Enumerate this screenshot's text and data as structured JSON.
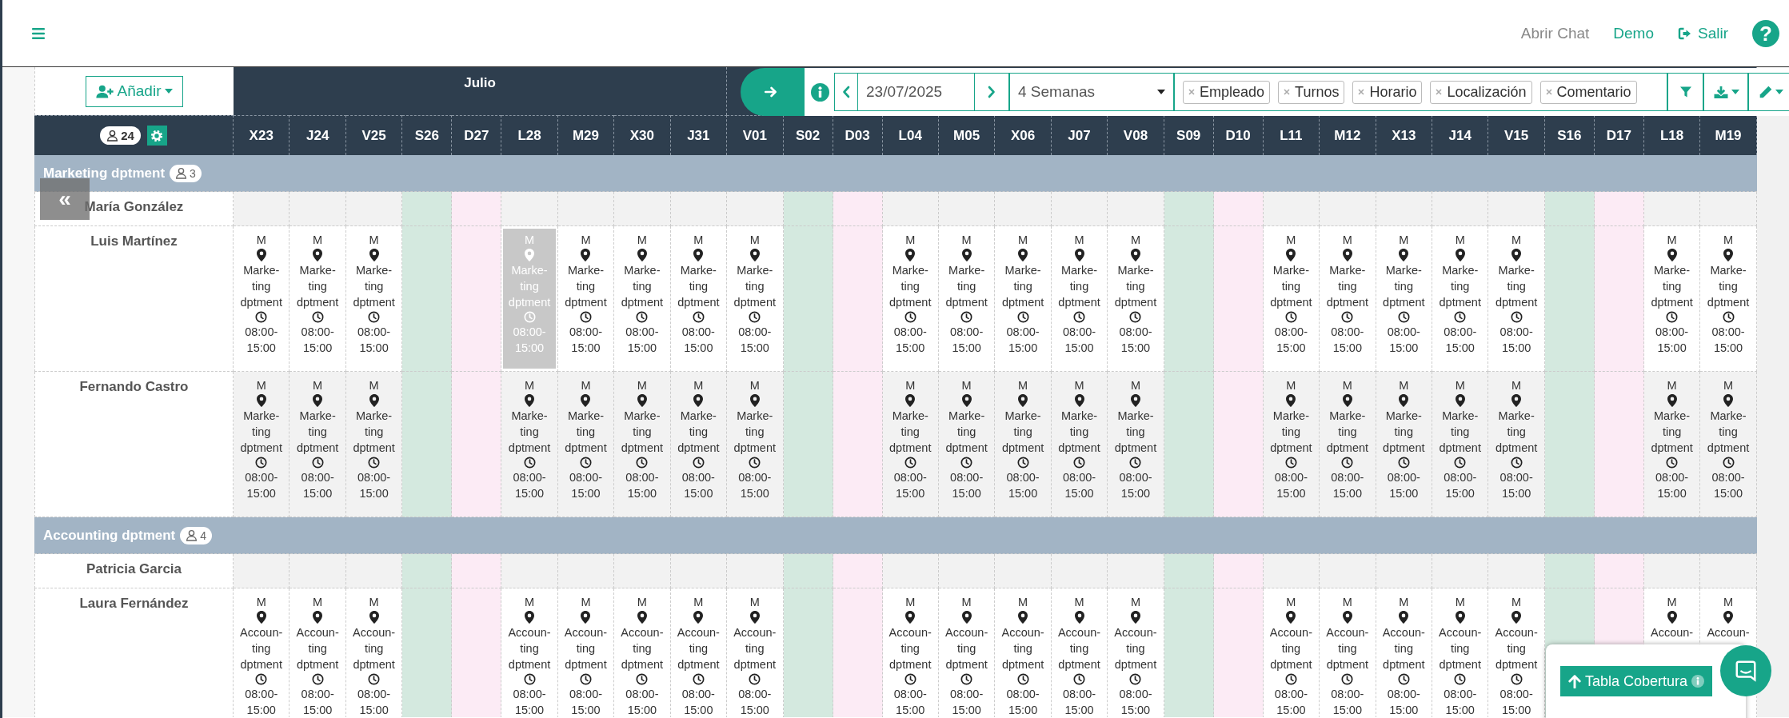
{
  "topbar": {
    "links": [
      {
        "label": "Abrir Chat",
        "kind": "muted"
      },
      {
        "label": "Demo",
        "kind": "accent"
      },
      {
        "label": "Salir",
        "kind": "logout"
      }
    ],
    "help_label": "?"
  },
  "toolbar": {
    "date": "23/07/2025",
    "range": "4 Semanas",
    "tags": [
      {
        "label": "Empleado"
      },
      {
        "label": "Turnos"
      },
      {
        "label": "Horario"
      },
      {
        "label": "Localización"
      },
      {
        "label": "Comentario"
      }
    ]
  },
  "schedule": {
    "add_label": "Añadir",
    "staff_count": "24",
    "collapse_label": "«",
    "months": [
      {
        "label": "Julio",
        "days": [
          {
            "label": "X23",
            "kind": "weekday"
          },
          {
            "label": "J24",
            "kind": "weekday"
          },
          {
            "label": "V25",
            "kind": "weekday"
          },
          {
            "label": "S26",
            "kind": "saturday"
          },
          {
            "label": "D27",
            "kind": "sunday"
          },
          {
            "label": "L28",
            "kind": "weekday"
          },
          {
            "label": "M29",
            "kind": "weekday"
          },
          {
            "label": "X30",
            "kind": "weekday"
          },
          {
            "label": "J31",
            "kind": "weekday"
          }
        ]
      },
      {
        "days": [
          {
            "label": "V01",
            "kind": "weekday"
          },
          {
            "label": "S02",
            "kind": "saturday"
          },
          {
            "label": "D03",
            "kind": "sunday"
          },
          {
            "label": "L04",
            "kind": "weekday"
          },
          {
            "label": "M05",
            "kind": "weekday"
          },
          {
            "label": "X06",
            "kind": "weekday"
          },
          {
            "label": "J07",
            "kind": "weekday"
          },
          {
            "label": "V08",
            "kind": "weekday"
          },
          {
            "label": "S09",
            "kind": "saturday"
          },
          {
            "label": "D10",
            "kind": "sunday"
          },
          {
            "label": "L11",
            "kind": "weekday"
          },
          {
            "label": "M12",
            "kind": "weekday"
          },
          {
            "label": "X13",
            "kind": "weekday"
          },
          {
            "label": "J14",
            "kind": "weekday"
          },
          {
            "label": "V15",
            "kind": "weekday"
          },
          {
            "label": "S16",
            "kind": "saturday"
          },
          {
            "label": "D17",
            "kind": "sunday"
          },
          {
            "label": "L18",
            "kind": "weekday"
          },
          {
            "label": "M19",
            "kind": "weekday"
          }
        ]
      }
    ],
    "groups": [
      {
        "name": "Marketing dptment",
        "count": "3",
        "employees": [
          {
            "name": "María González"
          },
          {
            "name": "Luis Martínez",
            "shifts": [
              {
                "kind": "shift",
                "code": "M",
                "location": "Marke-ting dptment",
                "time": "08:00-15:00",
                "selected": false
              },
              {
                "kind": "shift",
                "code": "M",
                "location": "Marke-ting dptment",
                "time": "08:00-15:00",
                "selected": false
              },
              {
                "kind": "shift",
                "code": "M",
                "location": "Marke-ting dptment",
                "time": "08:00-15:00",
                "selected": false
              },
              {
                "kind": "off"
              },
              {
                "kind": "off"
              },
              {
                "kind": "shift",
                "code": "M",
                "location": "Marke-ting dptment",
                "time": "08:00-15:00",
                "selected": true
              },
              {
                "kind": "shift",
                "code": "M",
                "location": "Marke-ting dptment",
                "time": "08:00-15:00",
                "selected": false
              },
              {
                "kind": "shift",
                "code": "M",
                "location": "Marke-ting dptment",
                "time": "08:00-15:00",
                "selected": false
              },
              {
                "kind": "shift",
                "code": "M",
                "location": "Marke-ting dptment",
                "time": "08:00-15:00",
                "selected": false
              },
              {
                "kind": "shift",
                "code": "M",
                "location": "Marke-ting dptment",
                "time": "08:00-15:00",
                "selected": false
              },
              {
                "kind": "off"
              },
              {
                "kind": "off"
              },
              {
                "kind": "shift",
                "code": "M",
                "location": "Marke-ting dptment",
                "time": "08:00-15:00",
                "selected": false
              },
              {
                "kind": "shift",
                "code": "M",
                "location": "Marke-ting dptment",
                "time": "08:00-15:00",
                "selected": false
              },
              {
                "kind": "shift",
                "code": "M",
                "location": "Marke-ting dptment",
                "time": "08:00-15:00",
                "selected": false
              },
              {
                "kind": "shift",
                "code": "M",
                "location": "Marke-ting dptment",
                "time": "08:00-15:00",
                "selected": false
              },
              {
                "kind": "shift",
                "code": "M",
                "location": "Marke-ting dptment",
                "time": "08:00-15:00",
                "selected": false
              },
              {
                "kind": "off"
              },
              {
                "kind": "off"
              },
              {
                "kind": "shift",
                "code": "M",
                "location": "Marke-ting dptment",
                "time": "08:00-15:00",
                "selected": false
              },
              {
                "kind": "shift",
                "code": "M",
                "location": "Marke-ting dptment",
                "time": "08:00-15:00",
                "selected": false
              },
              {
                "kind": "shift",
                "code": "M",
                "location": "Marke-ting dptment",
                "time": "08:00-15:00",
                "selected": false
              },
              {
                "kind": "shift",
                "code": "M",
                "location": "Marke-ting dptment",
                "time": "08:00-15:00",
                "selected": false
              },
              {
                "kind": "shift",
                "code": "M",
                "location": "Marke-ting dptment",
                "time": "08:00-15:00",
                "selected": false
              },
              {
                "kind": "off"
              },
              {
                "kind": "off"
              },
              {
                "kind": "shift",
                "code": "M",
                "location": "Marke-ting dptment",
                "time": "08:00-15:00",
                "selected": false
              },
              {
                "kind": "shift",
                "code": "M",
                "location": "Marke-ting dptment",
                "time": "08:00-15:00",
                "selected": false
              }
            ]
          },
          {
            "name": "Fernando Castro",
            "shifts": [
              {
                "kind": "shift",
                "code": "M",
                "location": "Marke-ting dptment",
                "time": "08:00-15:00",
                "selected": false
              },
              {
                "kind": "shift",
                "code": "M",
                "location": "Marke-ting dptment",
                "time": "08:00-15:00",
                "selected": false
              },
              {
                "kind": "shift",
                "code": "M",
                "location": "Marke-ting dptment",
                "time": "08:00-15:00",
                "selected": false
              },
              {
                "kind": "off"
              },
              {
                "kind": "off"
              },
              {
                "kind": "shift",
                "code": "M",
                "location": "Marke-ting dptment",
                "time": "08:00-15:00",
                "selected": false
              },
              {
                "kind": "shift",
                "code": "M",
                "location": "Marke-ting dptment",
                "time": "08:00-15:00",
                "selected": false
              },
              {
                "kind": "shift",
                "code": "M",
                "location": "Marke-ting dptment",
                "time": "08:00-15:00",
                "selected": false
              },
              {
                "kind": "shift",
                "code": "M",
                "location": "Marke-ting dptment",
                "time": "08:00-15:00",
                "selected": false
              },
              {
                "kind": "shift",
                "code": "M",
                "location": "Marke-ting dptment",
                "time": "08:00-15:00",
                "selected": false
              },
              {
                "kind": "off"
              },
              {
                "kind": "off"
              },
              {
                "kind": "shift",
                "code": "M",
                "location": "Marke-ting dptment",
                "time": "08:00-15:00",
                "selected": false
              },
              {
                "kind": "shift",
                "code": "M",
                "location": "Marke-ting dptment",
                "time": "08:00-15:00",
                "selected": false
              },
              {
                "kind": "shift",
                "code": "M",
                "location": "Marke-ting dptment",
                "time": "08:00-15:00",
                "selected": false
              },
              {
                "kind": "shift",
                "code": "M",
                "location": "Marke-ting dptment",
                "time": "08:00-15:00",
                "selected": false
              },
              {
                "kind": "shift",
                "code": "M",
                "location": "Marke-ting dptment",
                "time": "08:00-15:00",
                "selected": false
              },
              {
                "kind": "off"
              },
              {
                "kind": "off"
              },
              {
                "kind": "shift",
                "code": "M",
                "location": "Marke-ting dptment",
                "time": "08:00-15:00",
                "selected": false
              },
              {
                "kind": "shift",
                "code": "M",
                "location": "Marke-ting dptment",
                "time": "08:00-15:00",
                "selected": false
              },
              {
                "kind": "shift",
                "code": "M",
                "location": "Marke-ting dptment",
                "time": "08:00-15:00",
                "selected": false
              },
              {
                "kind": "shift",
                "code": "M",
                "location": "Marke-ting dptment",
                "time": "08:00-15:00",
                "selected": false
              },
              {
                "kind": "shift",
                "code": "M",
                "location": "Marke-ting dptment",
                "time": "08:00-15:00",
                "selected": false
              },
              {
                "kind": "off"
              },
              {
                "kind": "off"
              },
              {
                "kind": "shift",
                "code": "M",
                "location": "Marke-ting dptment",
                "time": "08:00-15:00",
                "selected": false
              },
              {
                "kind": "shift",
                "code": "M",
                "location": "Marke-ting dptment",
                "time": "08:00-15:00",
                "selected": false
              }
            ]
          }
        ]
      },
      {
        "name": "Accounting dptment",
        "count": "4",
        "employees": [
          {
            "name": "Patricia Garcia"
          },
          {
            "name": "Laura Fernández",
            "shifts": [
              {
                "kind": "shift",
                "code": "M",
                "location": "Accoun-ting dptment",
                "time": "08:00-15:00",
                "selected": false
              },
              {
                "kind": "shift",
                "code": "M",
                "location": "Accoun-ting dptment",
                "time": "08:00-15:00",
                "selected": false
              },
              {
                "kind": "shift",
                "code": "M",
                "location": "Accoun-ting dptment",
                "time": "08:00-15:00",
                "selected": false
              },
              {
                "kind": "off"
              },
              {
                "kind": "off"
              },
              {
                "kind": "shift",
                "code": "M",
                "location": "Accoun-ting dptment",
                "time": "08:00-15:00",
                "selected": false
              },
              {
                "kind": "shift",
                "code": "M",
                "location": "Accoun-ting dptment",
                "time": "08:00-15:00",
                "selected": false
              },
              {
                "kind": "shift",
                "code": "M",
                "location": "Accoun-ting dptment",
                "time": "08:00-15:00",
                "selected": false
              },
              {
                "kind": "shift",
                "code": "M",
                "location": "Accoun-ting dptment",
                "time": "08:00-15:00",
                "selected": false
              },
              {
                "kind": "shift",
                "code": "M",
                "location": "Accoun-ting dptment",
                "time": "08:00-15:00",
                "selected": false
              },
              {
                "kind": "off"
              },
              {
                "kind": "off"
              },
              {
                "kind": "shift",
                "code": "M",
                "location": "Accoun-ting dptment",
                "time": "08:00-15:00",
                "selected": false
              },
              {
                "kind": "shift",
                "code": "M",
                "location": "Accoun-ting dptment",
                "time": "08:00-15:00",
                "selected": false
              },
              {
                "kind": "shift",
                "code": "M",
                "location": "Accoun-ting dptment",
                "time": "08:00-15:00",
                "selected": false
              },
              {
                "kind": "shift",
                "code": "M",
                "location": "Accoun-ting dptment",
                "time": "08:00-15:00",
                "selected": false
              },
              {
                "kind": "shift",
                "code": "M",
                "location": "Accoun-ting dptment",
                "time": "08:00-15:00",
                "selected": false
              },
              {
                "kind": "off"
              },
              {
                "kind": "off"
              },
              {
                "kind": "shift",
                "code": "M",
                "location": "Accoun-ting dptment",
                "time": "08:00-15:00",
                "selected": false
              },
              {
                "kind": "shift",
                "code": "M",
                "location": "Accoun-ting dptment",
                "time": "08:00-15:00",
                "selected": false
              },
              {
                "kind": "shift",
                "code": "M",
                "location": "Accoun-ting dptment",
                "time": "08:00-15:00",
                "selected": false
              },
              {
                "kind": "shift",
                "code": "M",
                "location": "Accoun-ting dptment",
                "time": "08:00-15:00",
                "selected": false
              },
              {
                "kind": "shift",
                "code": "M",
                "location": "Accoun-ting dptment",
                "time": "08:00-15:00",
                "selected": false
              },
              {
                "kind": "off"
              },
              {
                "kind": "off"
              },
              {
                "kind": "shift",
                "code": "M",
                "location": "Accoun-",
                "selected": false
              },
              {
                "kind": "shift",
                "code": "M",
                "location": "Accoun-",
                "selected": false
              }
            ]
          }
        ]
      }
    ]
  },
  "coverage": {
    "label": "Tabla Cobertura"
  }
}
